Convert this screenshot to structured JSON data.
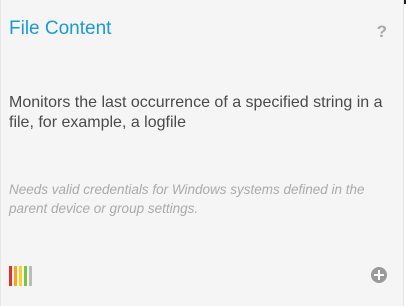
{
  "card": {
    "title": "File Content",
    "help_icon": "?",
    "description": "Monitors the last occurrence of a specified string in a file, for example, a logfile",
    "note": "Needs valid credentials for Windows systems defined in the parent device or group settings.",
    "performance_bar_colors": [
      "#e0312b",
      "#f5a623",
      "#f8d21c",
      "#7cc243",
      "#bbbbbb"
    ],
    "accent_color": "#1a9ad6"
  }
}
